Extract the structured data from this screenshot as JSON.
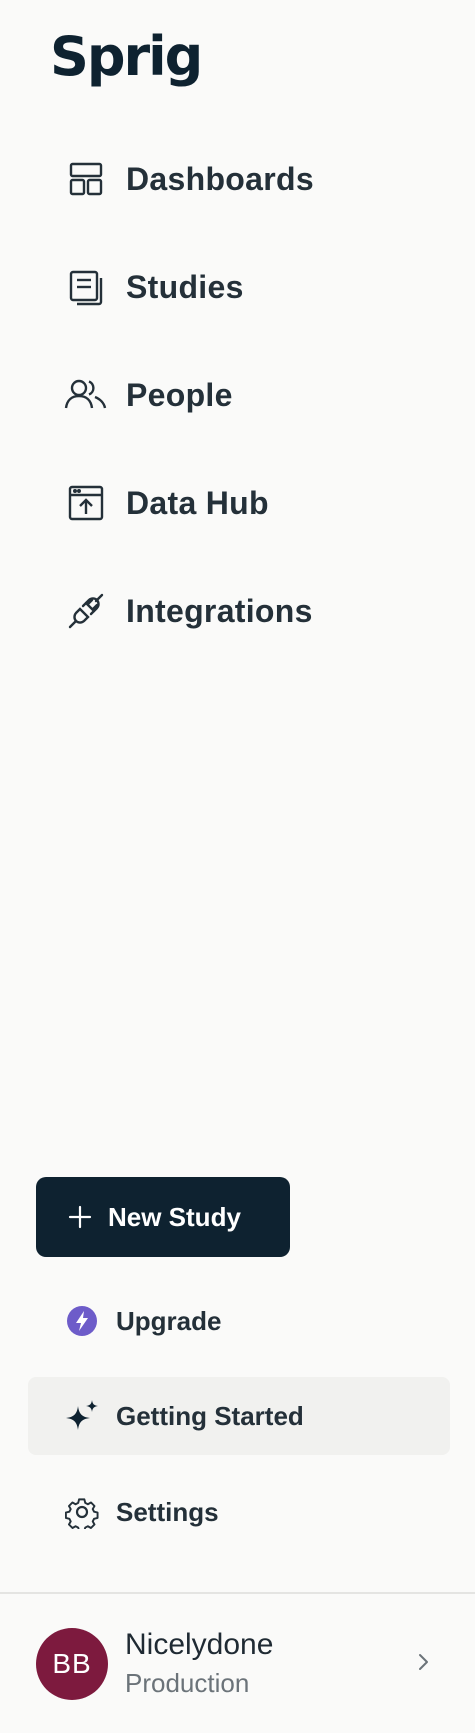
{
  "brand": {
    "logo_text": "Sprig"
  },
  "nav": {
    "items": [
      {
        "label": "Dashboards",
        "icon": "dashboard-icon"
      },
      {
        "label": "Studies",
        "icon": "studies-icon"
      },
      {
        "label": "People",
        "icon": "people-icon"
      },
      {
        "label": "Data Hub",
        "icon": "data-hub-icon"
      },
      {
        "label": "Integrations",
        "icon": "plug-icon"
      }
    ]
  },
  "actions": {
    "new_study_label": "New Study",
    "upgrade_label": "Upgrade",
    "getting_started_label": "Getting Started",
    "settings_label": "Settings"
  },
  "account": {
    "initials": "BB",
    "name": "Nicelydone",
    "environment": "Production"
  },
  "colors": {
    "background": "#fafaf9",
    "primary_dark": "#0e2230",
    "upgrade_accent": "#6d5cc9",
    "avatar": "#7d1a3e",
    "active_item": "#f1f1ef"
  }
}
